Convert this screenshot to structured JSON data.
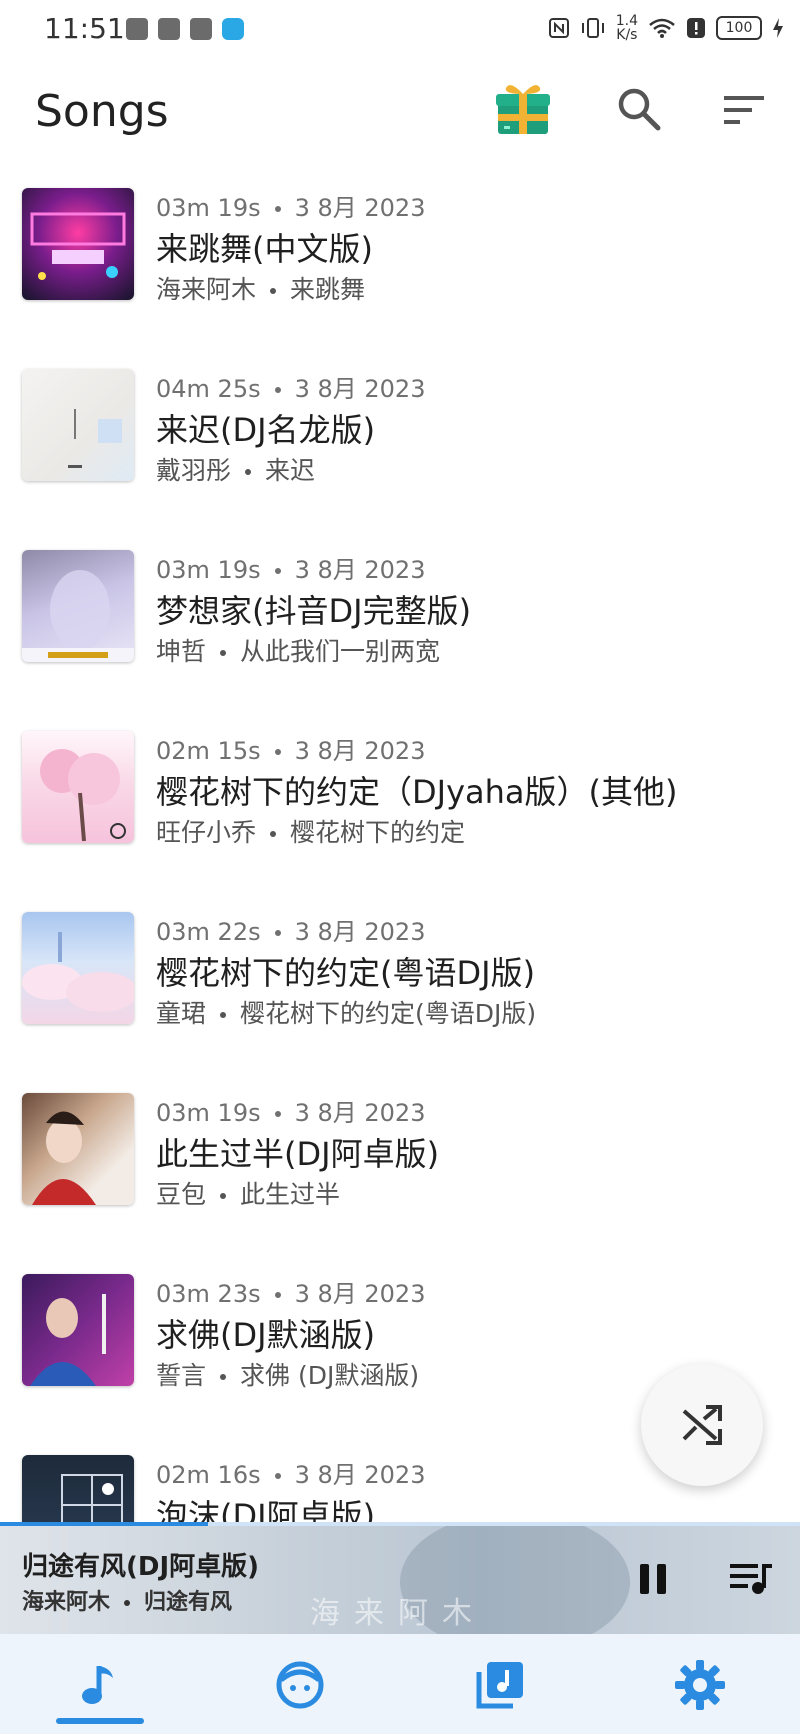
{
  "status_bar": {
    "time": "11:51",
    "net_speed_value": "1.4",
    "net_speed_unit": "K/s",
    "battery": "100"
  },
  "header": {
    "title": "Songs",
    "icons": [
      "gift-icon",
      "search-icon",
      "sort-icon"
    ]
  },
  "songs": [
    {
      "duration": "03m 19s",
      "date": "3 8月 2023",
      "title": "来跳舞(中文版)",
      "artist": "海来阿木",
      "album": "来跳舞"
    },
    {
      "duration": "04m 25s",
      "date": "3 8月 2023",
      "title": "来迟(DJ名龙版)",
      "artist": "戴羽彤",
      "album": "来迟"
    },
    {
      "duration": "03m 19s",
      "date": "3 8月 2023",
      "title": "梦想家(抖音DJ完整版)",
      "artist": "坤哲",
      "album": "从此我们一别两宽"
    },
    {
      "duration": "02m 15s",
      "date": "3 8月 2023",
      "title": "樱花树下的约定（DJyaha版）(其他)",
      "artist": "旺仔小乔",
      "album": "樱花树下的约定"
    },
    {
      "duration": "03m 22s",
      "date": "3 8月 2023",
      "title": "樱花树下的约定(粤语DJ版)",
      "artist": "童珺",
      "album": "樱花树下的约定(粤语DJ版)"
    },
    {
      "duration": "03m 19s",
      "date": "3 8月 2023",
      "title": "此生过半(DJ阿卓版)",
      "artist": "豆包",
      "album": "此生过半"
    },
    {
      "duration": "03m 23s",
      "date": "3 8月 2023",
      "title": "求佛(DJ默涵版)",
      "artist": "誓言",
      "album": "求佛 (DJ默涵版)"
    },
    {
      "duration": "02m 16s",
      "date": "3 8月 2023",
      "title": "泡沫(DJ阿卓版)",
      "artist": "",
      "album": ""
    }
  ],
  "now_playing": {
    "title": "归途有风(DJ阿卓版)",
    "artist": "海来阿木",
    "album": "归途有风",
    "progress": 0.26,
    "art_text": "海来阿木"
  },
  "fab": {
    "icon": "shuffle-icon"
  },
  "bottom_nav": {
    "items": [
      "songs-tab-icon",
      "artists-tab-icon",
      "albums-tab-icon",
      "settings-tab-icon"
    ],
    "active": 0,
    "accent": "#2a8be0"
  }
}
